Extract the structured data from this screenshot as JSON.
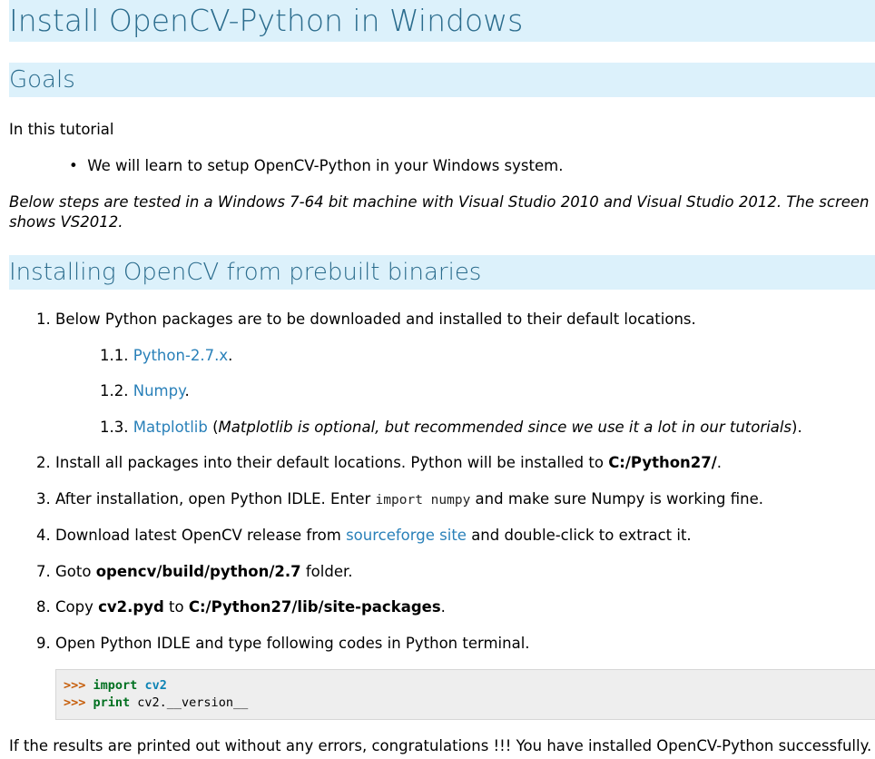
{
  "title": "Install OpenCV-Python in Windows",
  "goals": {
    "heading": "Goals",
    "intro": "In this tutorial",
    "bullet": "We will learn to setup OpenCV-Python in your Windows system.",
    "note_line1": "Below steps are tested in a Windows 7-64 bit machine with Visual Studio 2010 and Visual Studio 2012. The screen",
    "note_line2": "shows VS2012."
  },
  "install": {
    "heading": "Installing OpenCV from prebuilt binaries",
    "step1": {
      "num": "1.",
      "text": "Below Python packages are to be downloaded and installed to their default locations."
    },
    "sub": [
      {
        "num": "1.1.",
        "link": "Python-2.7.x",
        "after": "."
      },
      {
        "num": "1.2.",
        "link": "Numpy",
        "after": "."
      },
      {
        "num": "1.3.",
        "link": "Matplotlib",
        "mid_open": " (",
        "note": "Matplotlib is optional, but recommended since we use it a lot in our tutorials",
        "after": ")."
      }
    ],
    "step2": {
      "num": "2.",
      "text": "Install all packages into their default locations. Python will be installed to ",
      "bold": "C:/Python27/",
      "after": "."
    },
    "step3": {
      "num": "3.",
      "text": "After installation, open Python IDLE. Enter ",
      "code": "import numpy",
      "after": " and make sure Numpy is working fine."
    },
    "step4": {
      "num": "4.",
      "text": "Download latest OpenCV release from ",
      "link": "sourceforge site",
      "after": " and double-click to extract it."
    },
    "step7": {
      "num": "7.",
      "text": "Goto ",
      "bold": "opencv/build/python/2.7",
      "after": " folder."
    },
    "step8": {
      "num": "8.",
      "text": "Copy ",
      "bold1": "cv2.pyd",
      "mid": " to ",
      "bold2": "C:/Python27/lib/site-packages",
      "after": "."
    },
    "step9": {
      "num": "9.",
      "text": "Open Python IDLE and type following codes in Python terminal."
    },
    "code": {
      "line1": {
        "prompt": ">>> ",
        "kw": "import",
        "sp": " ",
        "name": "cv2"
      },
      "line2": {
        "prompt": ">>> ",
        "kw": "print",
        "rest": " cv2.__version__"
      }
    },
    "result": "If the results are printed out without any errors, congratulations !!! You have installed OpenCV-Python successfully."
  },
  "colors": {
    "heading_bg": "#dcf1fb",
    "heading_text": "#2b6c8d",
    "link": "#2980b9",
    "code_bg": "#eeeeee"
  }
}
